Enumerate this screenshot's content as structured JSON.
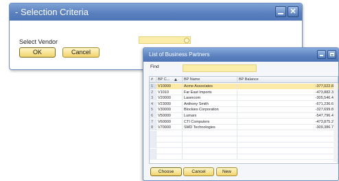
{
  "selection_dialog": {
    "title": "- Selection Criteria",
    "vendor_label": "Select Vendor",
    "vendor_value": "",
    "ok_label": "OK",
    "cancel_label": "Cancel"
  },
  "bp_list": {
    "title": "List of Business Partners",
    "find_label": "Find",
    "find_value": "",
    "columns": {
      "num": "#",
      "code": "BP C...",
      "name": "BP Name",
      "balance": "BP Balance"
    },
    "rows": [
      {
        "num": "1",
        "code": "V10000",
        "name": "Acme Associates",
        "balance": "-377,022.89"
      },
      {
        "num": "2",
        "code": "V1010",
        "name": "Far East Imports",
        "balance": "-473,882.39"
      },
      {
        "num": "3",
        "code": "V20000",
        "name": "Lasercom",
        "balance": "-305,546.47"
      },
      {
        "num": "4",
        "code": "V23000",
        "name": "Anthony Smith",
        "balance": "-671,236.62"
      },
      {
        "num": "5",
        "code": "V30000",
        "name": "Blockies Corporation",
        "balance": "-327,699.82"
      },
      {
        "num": "6",
        "code": "V50000",
        "name": "Lumarx",
        "balance": "-547,796.44"
      },
      {
        "num": "7",
        "code": "V60000",
        "name": "CTI Computers",
        "balance": "-473,875.25"
      },
      {
        "num": "8",
        "code": "V70000",
        "name": "SMD Technologies",
        "balance": "-309,386.72"
      }
    ],
    "choose_label": "Choose",
    "cancel_label": "Cancel",
    "new_label": "New"
  },
  "icons": {
    "minimize": "minimize-icon",
    "close": "close-icon",
    "maximize": "maximize-icon",
    "choose_from_list": "choose-from-list-icon",
    "sort": "sort-ascending-icon"
  },
  "colors": {
    "titlebar": "#5a80bf",
    "field_yellow": "#fbeeaa",
    "button_gold": "#f1d36a",
    "selected_row": "#fde9a6"
  }
}
